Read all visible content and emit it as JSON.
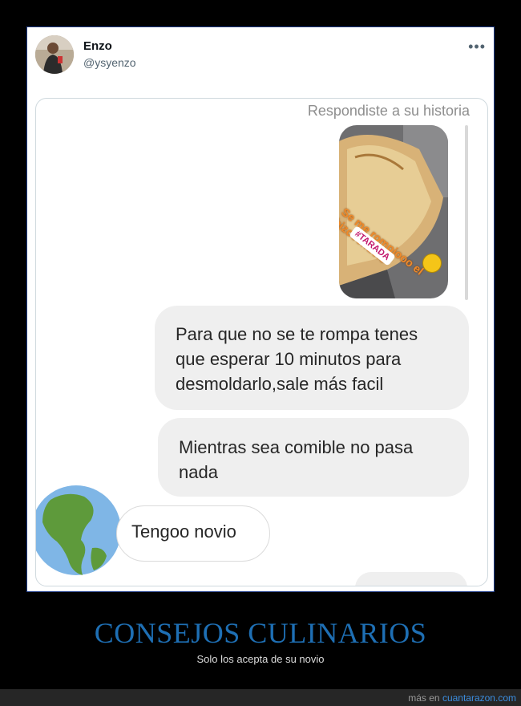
{
  "tweet": {
    "display_name": "Enzo",
    "handle": "@ysyenzo",
    "more_icon": "more-horizontal-icon"
  },
  "dm": {
    "reply_note": "Respondiste a su historia",
    "story": {
      "text": "Se me rompiooo el bizcochuelo",
      "tag": "#TARADA"
    },
    "messages": [
      {
        "from": "me",
        "text": "Para que no se te rompa tenes que esperar 10 minutos para desmoldarlo,sale más facil"
      },
      {
        "from": "me",
        "text": "Mientras sea comible no pasa nada"
      },
      {
        "from": "them",
        "text": "Tengoo novio"
      }
    ]
  },
  "caption": {
    "title": "CONSEJOS CULINARIOS",
    "subtitle": "Solo los acepta de su novio"
  },
  "footer": {
    "prefix": "más en ",
    "link": "cuantarazon.com"
  },
  "colors": {
    "caption_title": "#1e6fb4",
    "link": "#3b8ddf",
    "bubble": "#efefef"
  }
}
